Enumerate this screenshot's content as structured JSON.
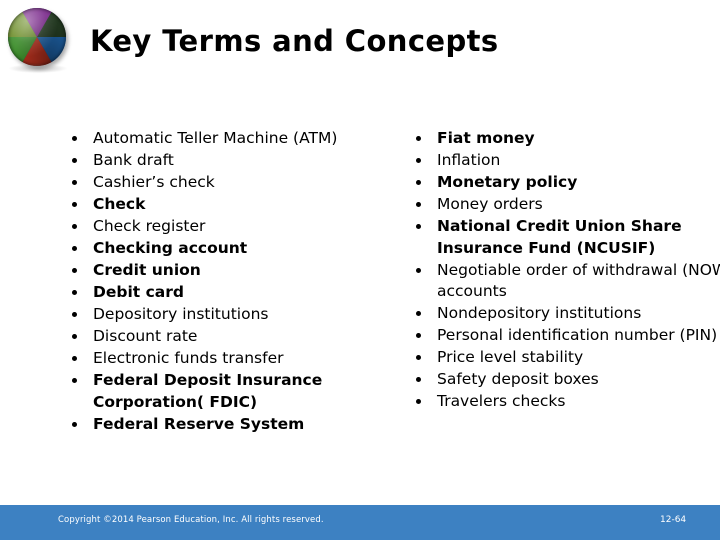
{
  "slide": {
    "title": "Key Terms and Concepts",
    "logo": {
      "icon": "pie-chart-sphere-logo",
      "segment_colors": [
        "#7b2a8c",
        "#3f8f2e",
        "#b32a1e",
        "#1f63a8",
        "#2e4f2a",
        "#8aa83a"
      ]
    },
    "columns": [
      {
        "id": "left",
        "items": [
          {
            "text": "Automatic Teller Machine (ATM)",
            "bold": false
          },
          {
            "text": "Bank draft",
            "bold": false
          },
          {
            "text": "Cashier’s check",
            "bold": false
          },
          {
            "text": "Check",
            "bold": true
          },
          {
            "text": "Check register",
            "bold": false
          },
          {
            "text": "Checking account",
            "bold": true
          },
          {
            "text": "Credit union",
            "bold": true
          },
          {
            "text": "Debit card",
            "bold": true
          },
          {
            "text": "Depository institutions",
            "bold": false
          },
          {
            "text": "Discount rate",
            "bold": false
          },
          {
            "text": "Electronic funds transfer",
            "bold": false
          },
          {
            "text": "Federal Deposit Insurance Corporation( FDIC)",
            "bold": true
          },
          {
            "text": "Federal Reserve System",
            "bold": true
          }
        ]
      },
      {
        "id": "right",
        "items": [
          {
            "text": "Fiat money",
            "bold": true
          },
          {
            "text": "Inflation",
            "bold": false
          },
          {
            "text": "Monetary policy",
            "bold": true
          },
          {
            "text": "Money orders",
            "bold": false
          },
          {
            "text": "National Credit Union Share Insurance Fund (NCUSIF)",
            "bold": true
          },
          {
            "text": "Negotiable order of withdrawal (NOW) accounts",
            "bold": false
          },
          {
            "text": "Nondepository institutions",
            "bold": false
          },
          {
            "text": "Personal identification number (PIN)",
            "bold": false
          },
          {
            "text": "Price level stability",
            "bold": false
          },
          {
            "text": "Safety deposit boxes",
            "bold": false
          },
          {
            "text": "Travelers checks",
            "bold": false
          }
        ]
      }
    ]
  },
  "footer": {
    "copyright": "Copyright ©2014 Pearson Education, Inc. All rights reserved.",
    "page_number": "12-64",
    "bar_color": "#3d81c2"
  }
}
